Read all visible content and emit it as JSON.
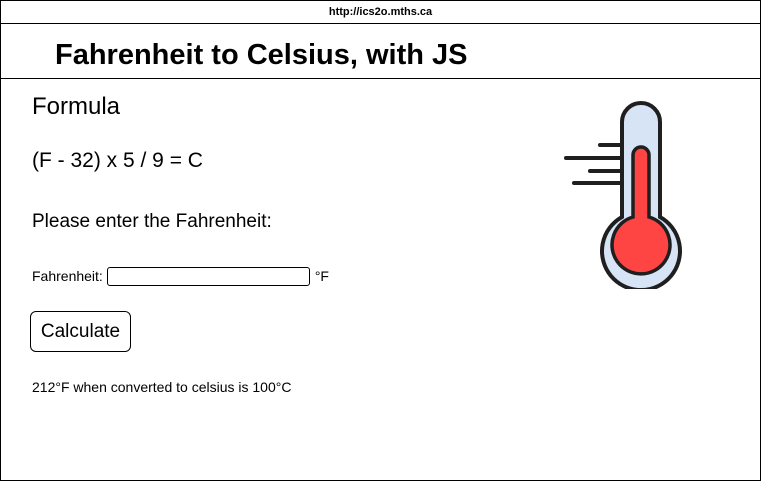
{
  "browser": {
    "url": "http://ics2o.mths.ca"
  },
  "header": {
    "title": "Fahrenheit to Celsius, with JS"
  },
  "main": {
    "formula_heading": "Formula",
    "formula": "(F - 32) x 5 / 9 = C",
    "prompt": "Please enter the Fahrenheit:",
    "field_label": "Fahrenheit:",
    "field_value": "",
    "field_placeholder": "",
    "unit": "°F",
    "calculate_label": "Calculate",
    "result": "212°F when converted to celsius is 100°C"
  },
  "illustration": {
    "icon": "thermometer-icon",
    "colors": {
      "tube": "#d6e4f5",
      "mercury": "#ff4444",
      "outline": "#1f1f1f"
    }
  }
}
